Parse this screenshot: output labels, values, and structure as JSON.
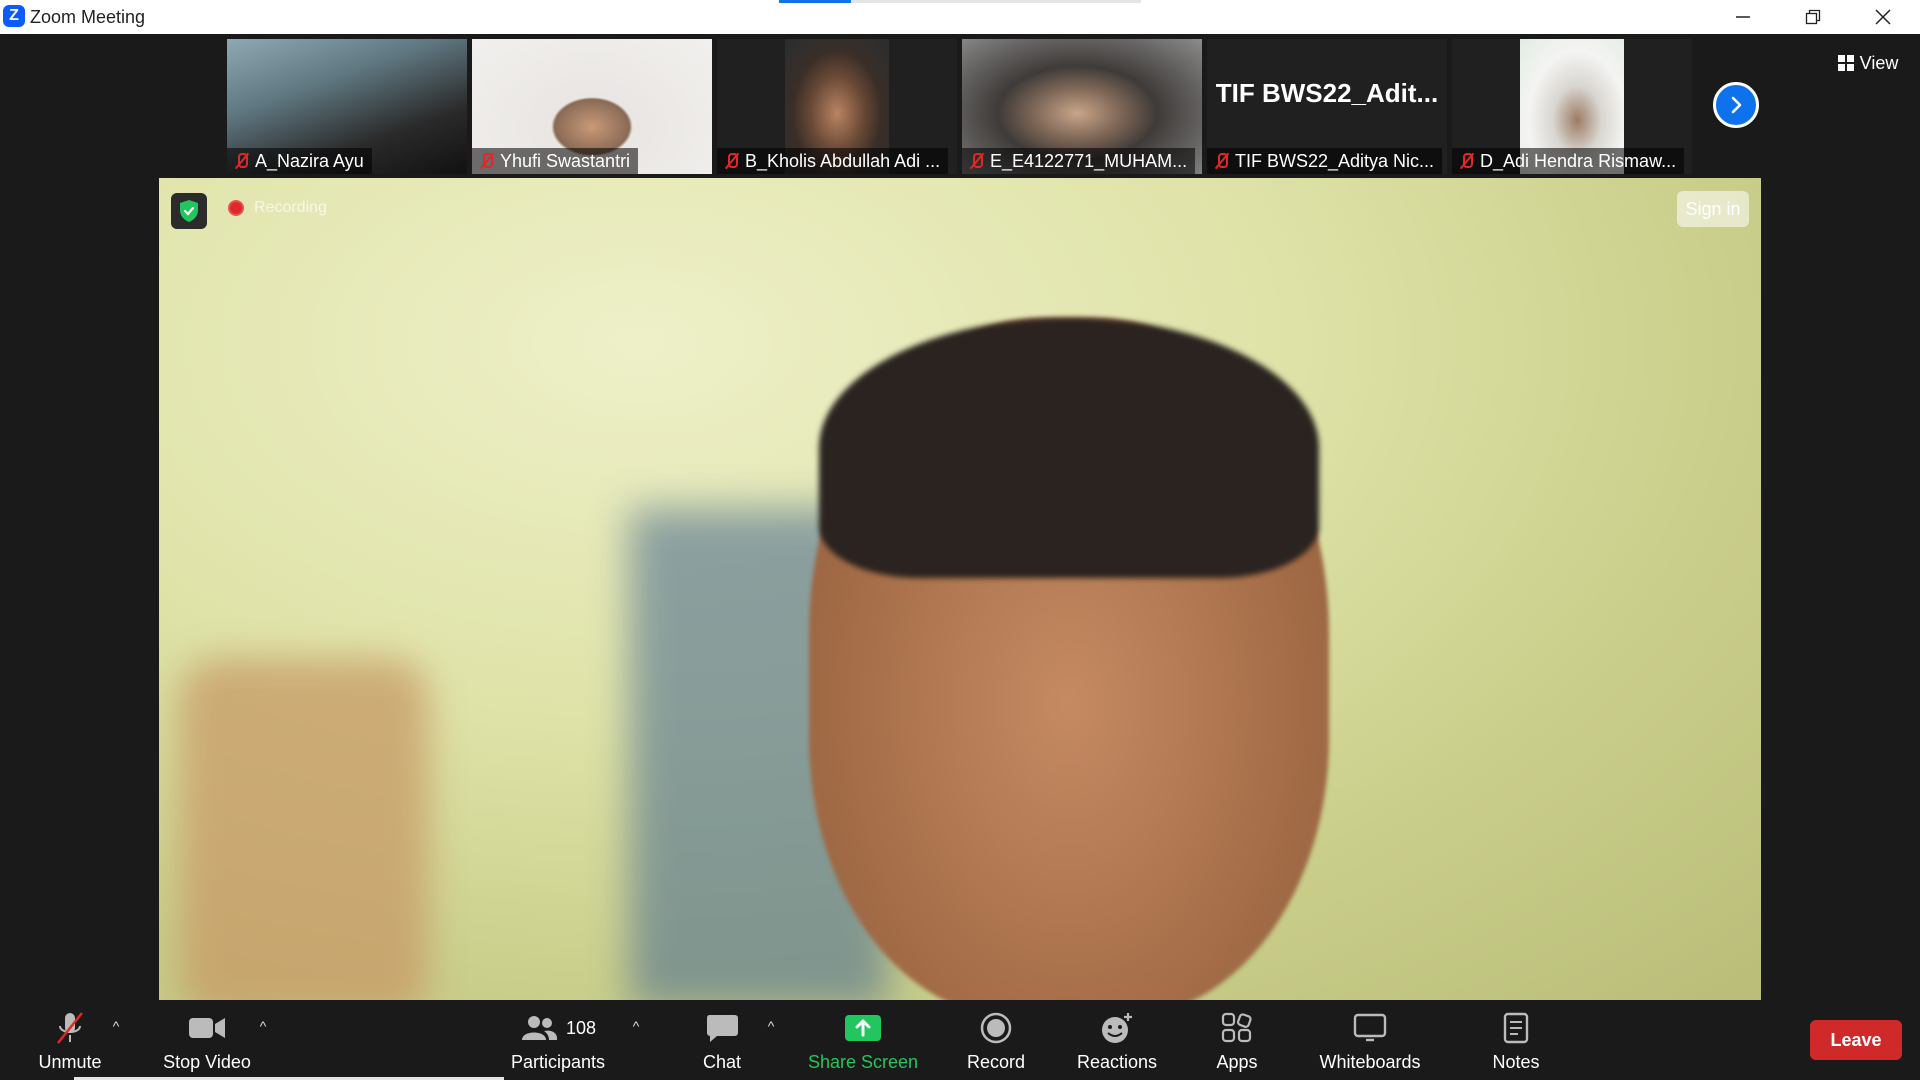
{
  "window": {
    "title": "Zoom Meeting",
    "app_icon_letter": "Z"
  },
  "meeting": {
    "progress_fraction": 0.2,
    "view_label": "View",
    "recording_label": "Recording",
    "sign_in_label": "Sign in"
  },
  "participants_strip": [
    {
      "name": "A_Nazira Ayu",
      "muted": true
    },
    {
      "name": "Yhufi Swastantri",
      "muted": true
    },
    {
      "name": "B_Kholis Abdullah Adi ...",
      "muted": true
    },
    {
      "name": "E_E4122771_MUHAM...",
      "muted": true
    },
    {
      "name": "TIF BWS22_Aditya Nic...",
      "muted": true,
      "display_name": "TIF  BWS22_Adit..."
    },
    {
      "name": "D_Adi Hendra Rismaw...",
      "muted": true
    }
  ],
  "toolbar": {
    "unmute": "Unmute",
    "stop_video": "Stop Video",
    "participants": "Participants",
    "participants_count": "108",
    "chat": "Chat",
    "share_screen": "Share Screen",
    "record": "Record",
    "reactions": "Reactions",
    "apps": "Apps",
    "whiteboards": "Whiteboards",
    "notes": "Notes",
    "leave": "Leave"
  },
  "colors": {
    "accent": "#0e72ed",
    "share_green": "#22c55e",
    "leave_red": "#d02929",
    "mute_red": "#e02828"
  }
}
